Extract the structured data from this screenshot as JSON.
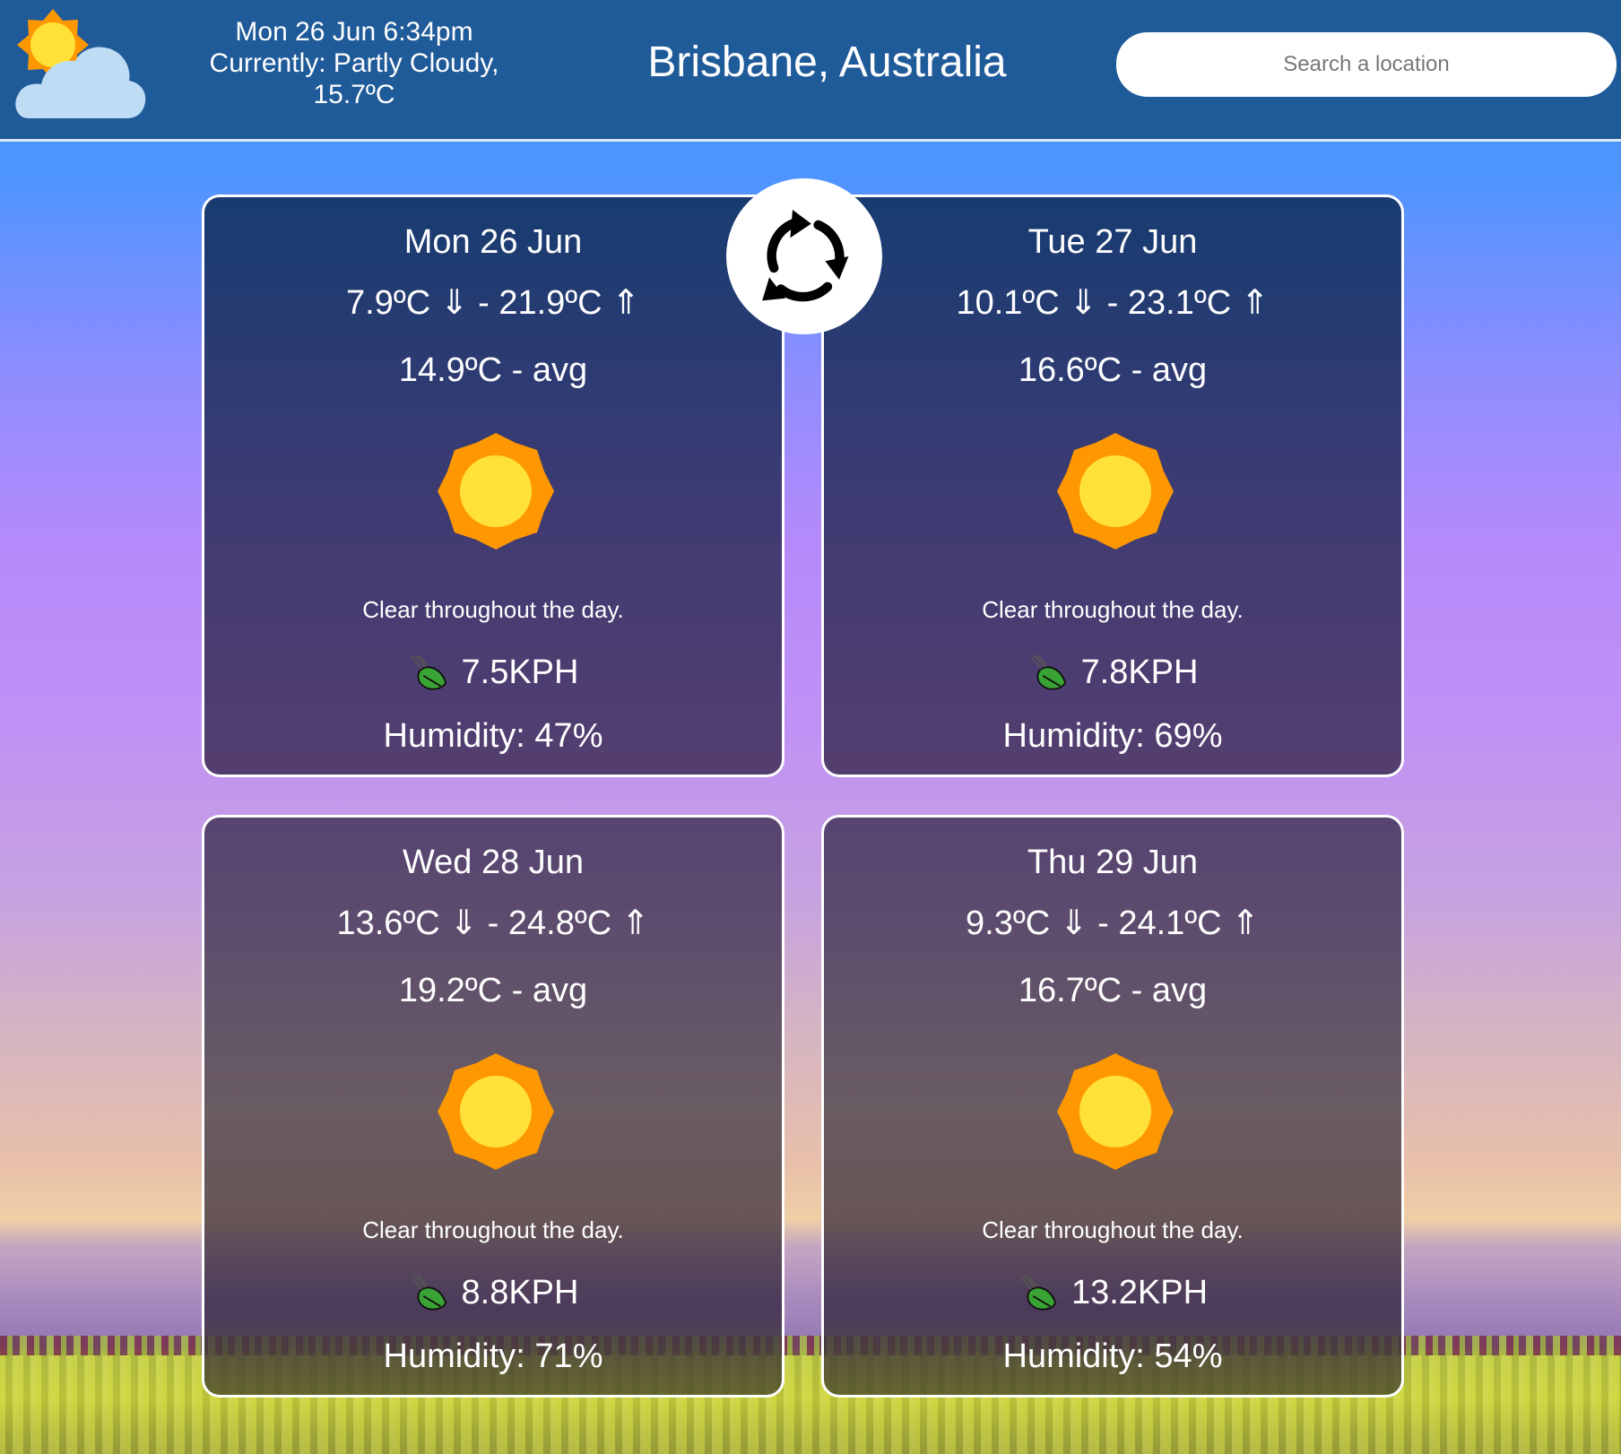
{
  "header": {
    "current_icon": "partly-cloudy-icon",
    "datetime": "Mon 26 Jun 6:34pm",
    "currently_line": "Currently: Partly Cloudy,",
    "current_temp": "15.7ºC",
    "city": "Brisbane, Australia",
    "search_placeholder": "Search a location"
  },
  "refresh_icon": "refresh-icon",
  "days": [
    {
      "date": "Mon 26 Jun",
      "range": "7.9ºC ⇓ - 21.9ºC ⇑",
      "avg": "14.9ºC - avg",
      "icon": "sun-icon",
      "description": "Clear throughout the day.",
      "wind": "7.5KPH",
      "humidity": "Humidity: 47%"
    },
    {
      "date": "Tue 27 Jun",
      "range": "10.1ºC ⇓ - 23.1ºC ⇑",
      "avg": "16.6ºC - avg",
      "icon": "sun-icon",
      "description": "Clear throughout the day.",
      "wind": "7.8KPH",
      "humidity": "Humidity: 69%"
    },
    {
      "date": "Wed 28 Jun",
      "range": "13.6ºC ⇓ - 24.8ºC ⇑",
      "avg": "19.2ºC - avg",
      "icon": "sun-icon",
      "description": "Clear throughout the day.",
      "wind": "8.8KPH",
      "humidity": "Humidity: 71%"
    },
    {
      "date": "Thu 29 Jun",
      "range": "9.3ºC ⇓ - 24.1ºC ⇑",
      "avg": "16.7ºC - avg",
      "icon": "sun-icon",
      "description": "Clear throughout the day.",
      "wind": "13.2KPH",
      "humidity": "Humidity: 54%"
    }
  ],
  "colors": {
    "header_bg": "#1f5a99",
    "sun_outer": "#ff9800",
    "sun_inner": "#ffe13a",
    "cloud": "#bfdcf5",
    "card_border": "#ffffff"
  }
}
